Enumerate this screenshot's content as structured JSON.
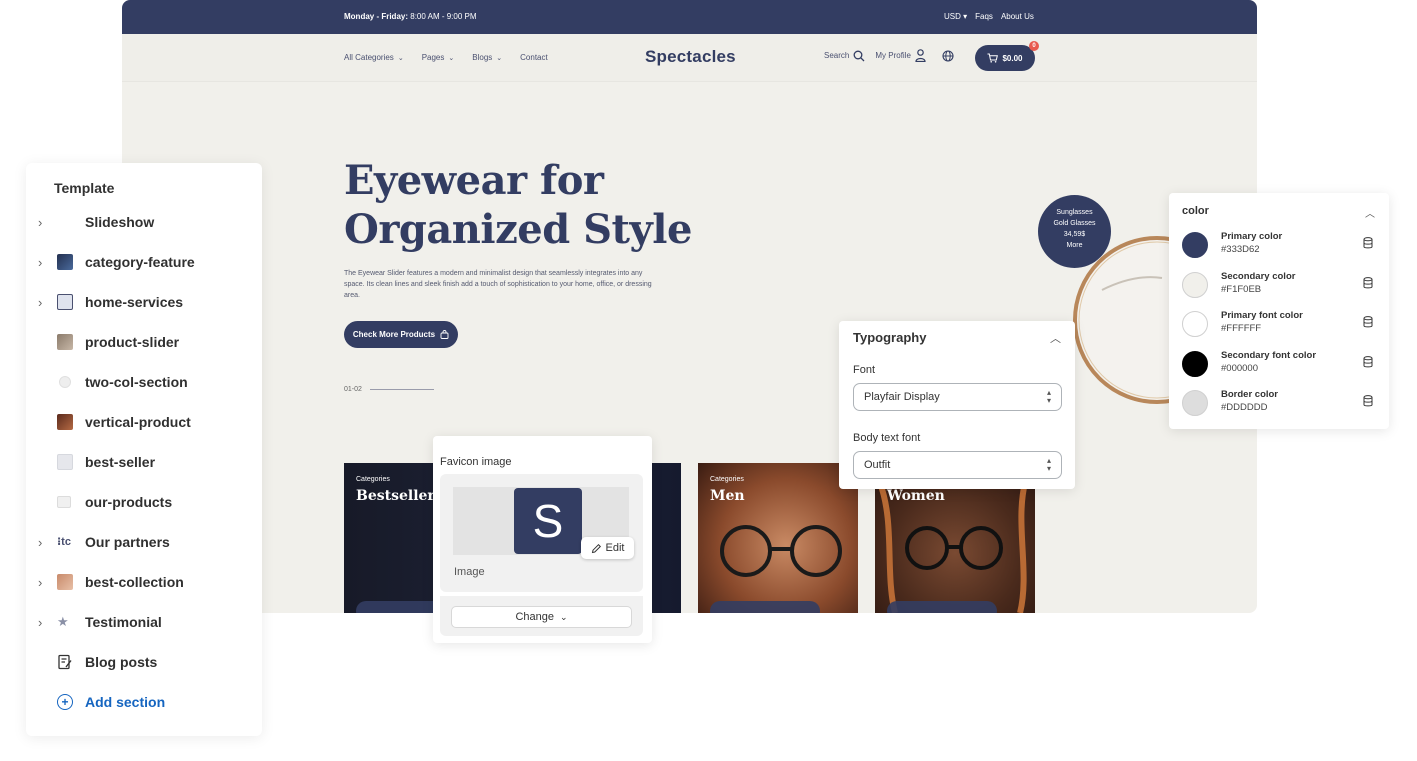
{
  "site": {
    "topbar": {
      "hours_day": "Monday - Friday:",
      "hours_time": "8:00 AM - 9:00 PM",
      "currency": "USD",
      "faqs": "Faqs",
      "about": "About Us"
    },
    "nav": {
      "links": [
        "All Categories",
        "Pages",
        "Blogs",
        "Contact"
      ],
      "logo": "Spectacles",
      "search": "Search",
      "profile": "My Profile",
      "cart_total": "$0.00",
      "cart_count": "0"
    },
    "hero": {
      "title_line1": "Eyewear for",
      "title_line2": "Organized Style",
      "description": "The Eyewear Slider features a modern and minimalist design that seamlessly integrates into any space. Its clean lines and sleek finish add a touch of sophistication to your home, office, or dressing area.",
      "button": "Check More Products",
      "pager": "01-02",
      "bubble": [
        "Sunglasses",
        "Gold Glasses",
        "34,59$",
        "More"
      ]
    },
    "cards": [
      {
        "category": "Categories",
        "name": "Bestsellers"
      },
      {
        "category": "Categories",
        "name": "Men"
      },
      {
        "category": "",
        "name": "Women"
      }
    ]
  },
  "template_panel": {
    "title": "Template",
    "items": [
      {
        "label": "Slideshow",
        "expandable": true,
        "icon": "none"
      },
      {
        "label": "category-feature",
        "expandable": true,
        "icon": "thumb-dark"
      },
      {
        "label": "home-services",
        "expandable": true,
        "icon": "thumb-grid"
      },
      {
        "label": "product-slider",
        "expandable": false,
        "icon": "thumb-product"
      },
      {
        "label": "two-col-section",
        "expandable": false,
        "icon": "thumb-light"
      },
      {
        "label": "vertical-product",
        "expandable": false,
        "icon": "thumb-portrait"
      },
      {
        "label": "best-seller",
        "expandable": false,
        "icon": "thumb-light"
      },
      {
        "label": "our-products",
        "expandable": false,
        "icon": "thumb-light"
      },
      {
        "label": "Our partners",
        "expandable": true,
        "icon": "thumb-logo"
      },
      {
        "label": "best-collection",
        "expandable": true,
        "icon": "thumb-portrait"
      },
      {
        "label": "Testimonial",
        "expandable": true,
        "icon": "thumb-star"
      },
      {
        "label": "Blog posts",
        "expandable": false,
        "icon": "blog-icon"
      },
      {
        "label": "Add section",
        "expandable": false,
        "icon": "plus-circle-icon"
      }
    ]
  },
  "favicon": {
    "label": "Favicon image",
    "letter": "S",
    "edit": "Edit",
    "image_label": "Image",
    "change": "Change"
  },
  "typography": {
    "title": "Typography",
    "font_label": "Font",
    "font_value": "Playfair Display",
    "body_label": "Body text font",
    "body_value": "Outfit"
  },
  "color": {
    "title": "color",
    "swatches": [
      {
        "name": "Primary color",
        "hex": "#333D62"
      },
      {
        "name": "Secondary color",
        "hex": "#F1F0EB"
      },
      {
        "name": "Primary font color",
        "hex": "#FFFFFF"
      },
      {
        "name": "Secondary font color",
        "hex": "#000000"
      },
      {
        "name": "Border color",
        "hex": "#DDDDDD"
      }
    ]
  }
}
